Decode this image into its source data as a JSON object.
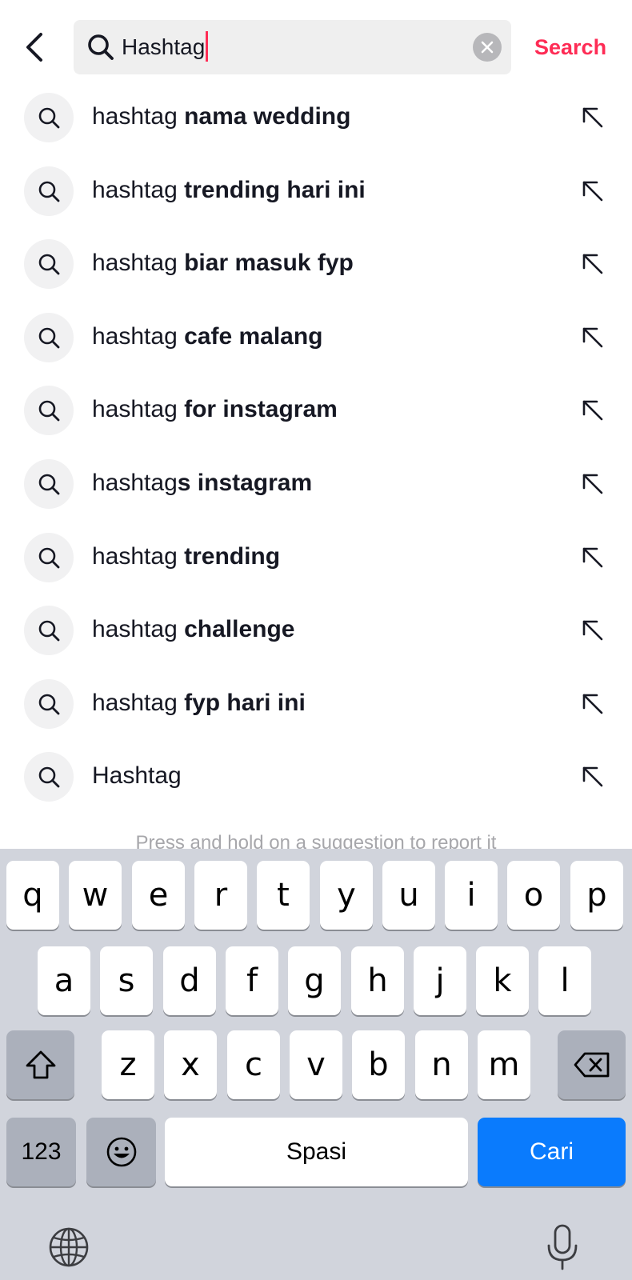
{
  "search": {
    "back_icon": "chevron-left-icon",
    "query": "Hashtag",
    "search_icon": "search-icon",
    "clear_icon": "clear-x-icon",
    "action_label": "Search"
  },
  "suggestions": [
    {
      "prefix": "hashtag ",
      "bold": "nama wedding"
    },
    {
      "prefix": "hashtag ",
      "bold": "trending hari ini"
    },
    {
      "prefix": "hashtag ",
      "bold": "biar masuk fyp"
    },
    {
      "prefix": "hashtag ",
      "bold": "cafe malang"
    },
    {
      "prefix": "hashtag ",
      "bold": "for instagram"
    },
    {
      "prefix": "hashtag",
      "bold": "s instagram"
    },
    {
      "prefix": "hashtag ",
      "bold": "trending"
    },
    {
      "prefix": "hashtag ",
      "bold": "challenge"
    },
    {
      "prefix": "hashtag ",
      "bold": "fyp hari ini"
    },
    {
      "prefix": "Hashtag",
      "bold": ""
    }
  ],
  "hint": "Press and hold on a suggestion to report it",
  "keyboard": {
    "row1": [
      "q",
      "w",
      "e",
      "r",
      "t",
      "y",
      "u",
      "i",
      "o",
      "p"
    ],
    "row2": [
      "a",
      "s",
      "d",
      "f",
      "g",
      "h",
      "j",
      "k",
      "l"
    ],
    "row3": [
      "z",
      "x",
      "c",
      "v",
      "b",
      "n",
      "m"
    ],
    "numbers_label": "123",
    "space_label": "Spasi",
    "return_label": "Cari",
    "return_color": "#0a7bfd"
  },
  "colors": {
    "accent": "#fe2c55",
    "keyboard_bg": "#d1d4dc"
  }
}
